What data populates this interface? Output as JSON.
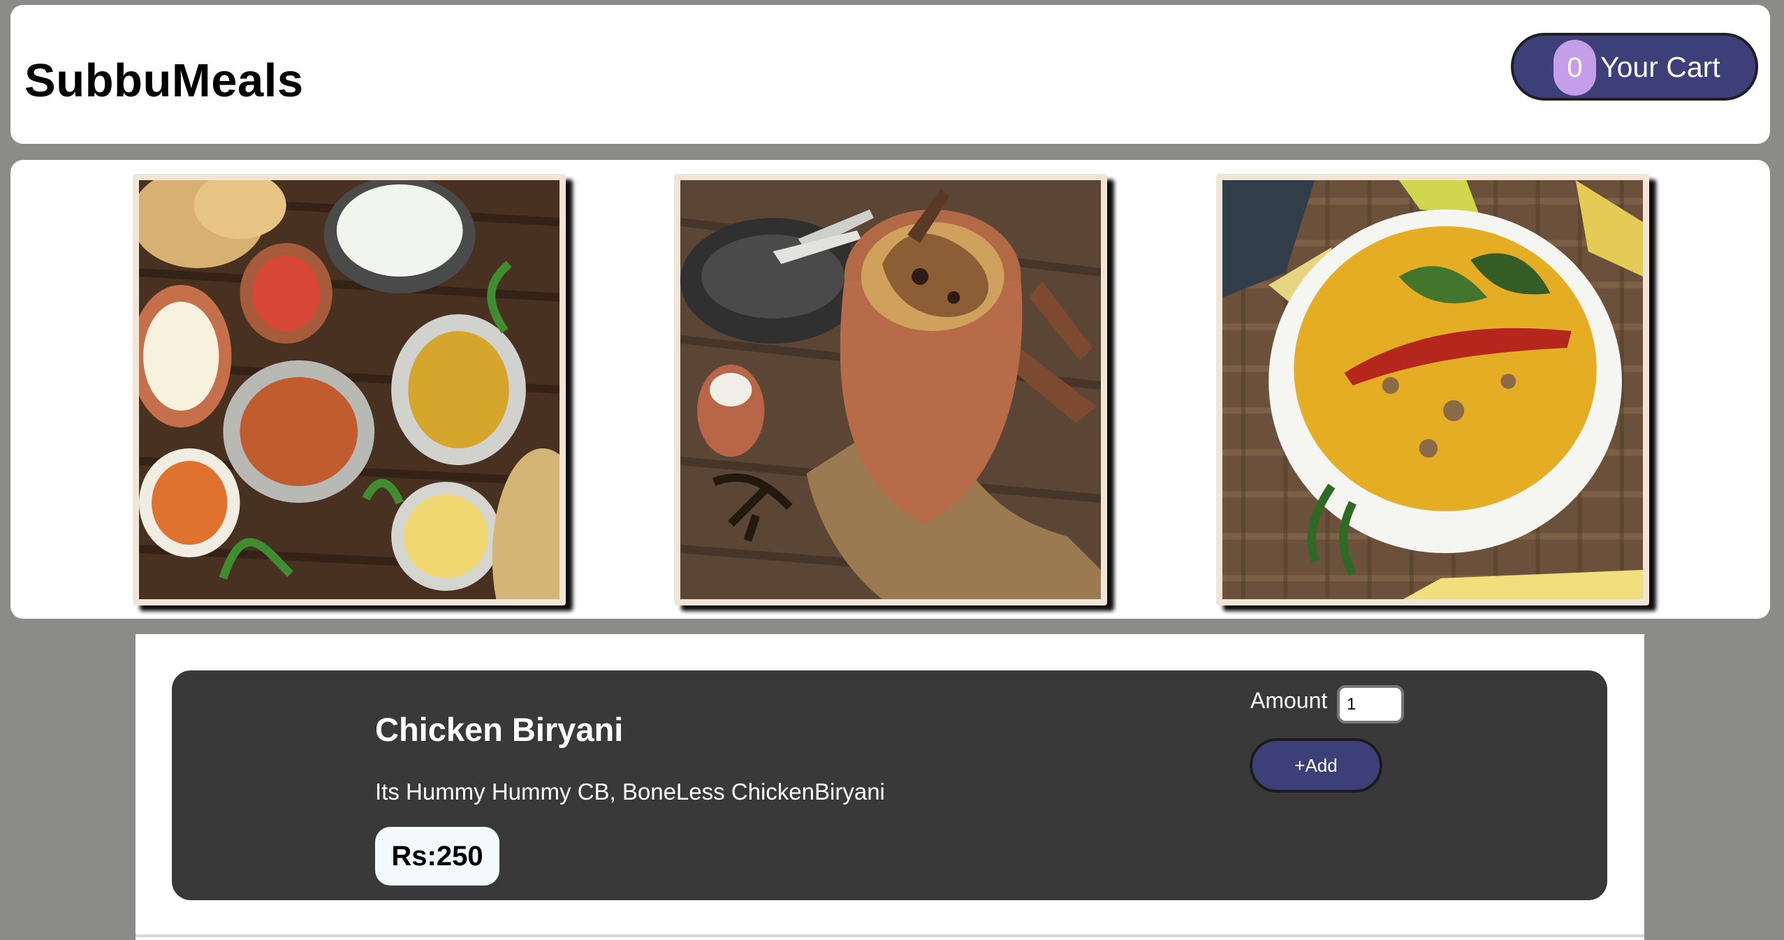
{
  "app": {
    "brand": "SubbuMeals"
  },
  "cart": {
    "count": "0",
    "label": "Your Cart",
    "button_color": "#3d3f78",
    "badge_color": "#c59ee9"
  },
  "gallery": {
    "images": [
      {
        "name": "Indian food spread image",
        "caption": ""
      },
      {
        "name": "Chicken biryani pot image",
        "caption": ""
      },
      {
        "name": "Yellow dal bowl image",
        "caption": ""
      }
    ]
  },
  "meal": {
    "name": "Chicken Biryani",
    "description": "Its Hummy Hummy CB, BoneLess ChickenBiryani",
    "price": "Rs:250",
    "amount_label": "Amount",
    "amount_value": "1",
    "add_label": "+Add",
    "card_color": "#393939"
  }
}
